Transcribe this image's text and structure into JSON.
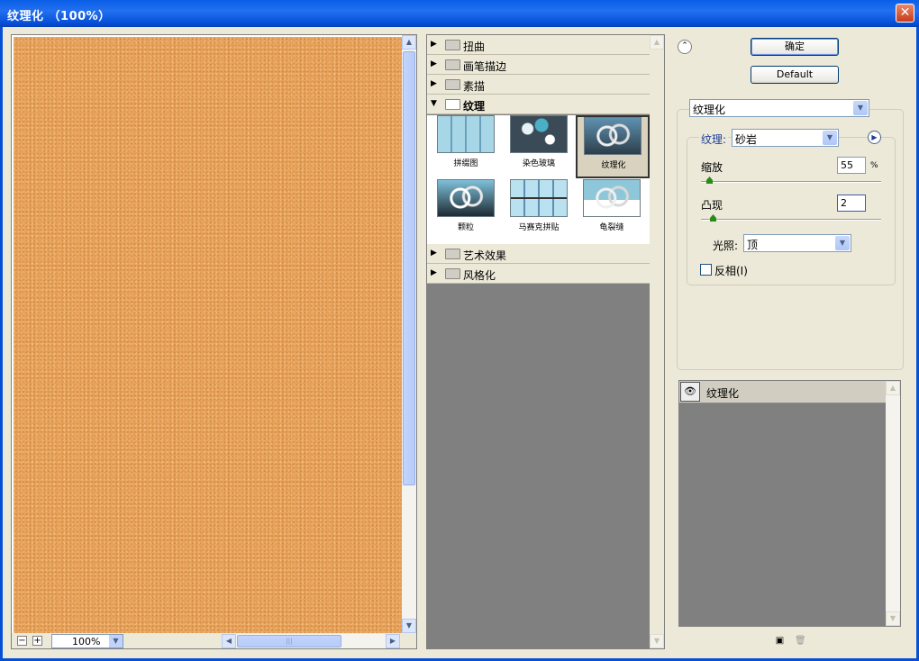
{
  "window": {
    "title": "纹理化 （100%）",
    "close_glyph": "✕"
  },
  "preview": {
    "zoom_value": "100%",
    "zoom_out": "−",
    "zoom_in": "+",
    "scroll_up": "▲",
    "scroll_down": "▼",
    "scroll_left": "◀",
    "scroll_right": "▶",
    "texture_color": "#e8a259"
  },
  "filter_tree": {
    "groups": [
      {
        "label": "扭曲",
        "expanded": false
      },
      {
        "label": "画笔描边",
        "expanded": false
      },
      {
        "label": "素描",
        "expanded": false
      },
      {
        "label": "纹理",
        "expanded": true
      },
      {
        "label": "艺术效果",
        "expanded": false
      },
      {
        "label": "风格化",
        "expanded": false
      }
    ],
    "collapsed_arrow": "▶",
    "expanded_arrow": "▼",
    "thumbnails": [
      {
        "caption": "拼缀图",
        "selected": false
      },
      {
        "caption": "染色玻璃",
        "selected": false
      },
      {
        "caption": "纹理化",
        "selected": true
      },
      {
        "caption": "颗粒",
        "selected": false
      },
      {
        "caption": "马赛克拼贴",
        "selected": false
      },
      {
        "caption": "龟裂缝",
        "selected": false
      }
    ]
  },
  "actions": {
    "ok_label": "确定",
    "default_label": "Default",
    "collapse_glyph": "⌃"
  },
  "settings": {
    "filter_select": "纹理化",
    "texture_label": "纹理:",
    "texture_value": "砂岩",
    "menu_glyph": "▶",
    "scale_label": "缩放",
    "scale_value": "55",
    "scale_unit": "%",
    "scale_fraction": 0.03,
    "relief_label": "凸现",
    "relief_value": "2",
    "relief_fraction": 0.05,
    "light_label": "光照:",
    "light_value": "顶",
    "invert_label": "反相(I)",
    "invert_checked": false,
    "dropdown_glyph": "▼"
  },
  "layers": {
    "items": [
      {
        "name": "纹理化",
        "visible": true
      }
    ],
    "eye_glyph": "👁",
    "new_layer_glyph": "▣",
    "delete_glyph": "🗑"
  }
}
